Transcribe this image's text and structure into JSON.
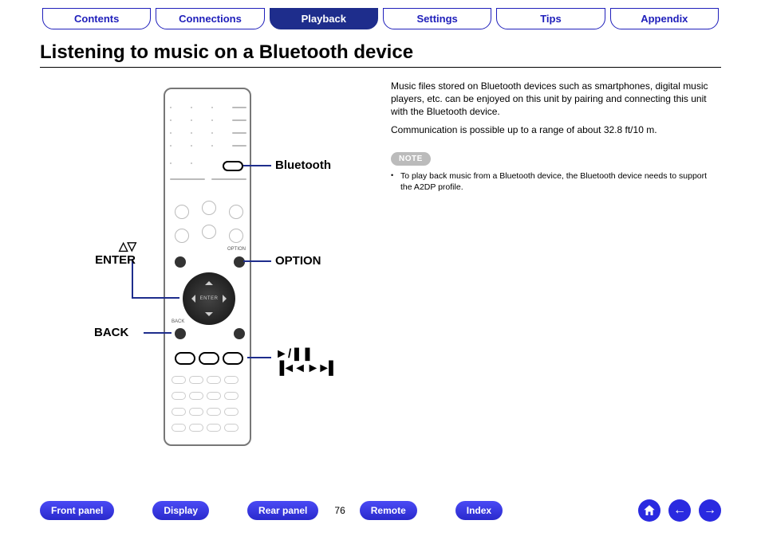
{
  "tabs": {
    "contents": "Contents",
    "connections": "Connections",
    "playback": "Playback",
    "settings": "Settings",
    "tips": "Tips",
    "appendix": "Appendix",
    "active": "playback"
  },
  "title": "Listening to music on a Bluetooth device",
  "callouts": {
    "bluetooth": "Bluetooth",
    "option": "OPTION",
    "enter_arrows": "△▽",
    "enter": "ENTER",
    "back": "BACK",
    "play_pause_sym": "►/❚❚",
    "prev_next_sym": "▐◄◄  ►►▌"
  },
  "body": {
    "para1": "Music files stored on Bluetooth devices such as smartphones, digital music players, etc. can be enjoyed on this unit by pairing and connecting this unit with the Bluetooth device.",
    "para2": "Communication is possible up to a range of about 32.8 ft/10 m.",
    "note_label": "NOTE",
    "note1": "To play back music from a Bluetooth device, the Bluetooth device needs to support the A2DP profile."
  },
  "footer": {
    "front_panel": "Front panel",
    "display": "Display",
    "rear_panel": "Rear panel",
    "remote": "Remote",
    "index": "Index",
    "page": "76"
  }
}
